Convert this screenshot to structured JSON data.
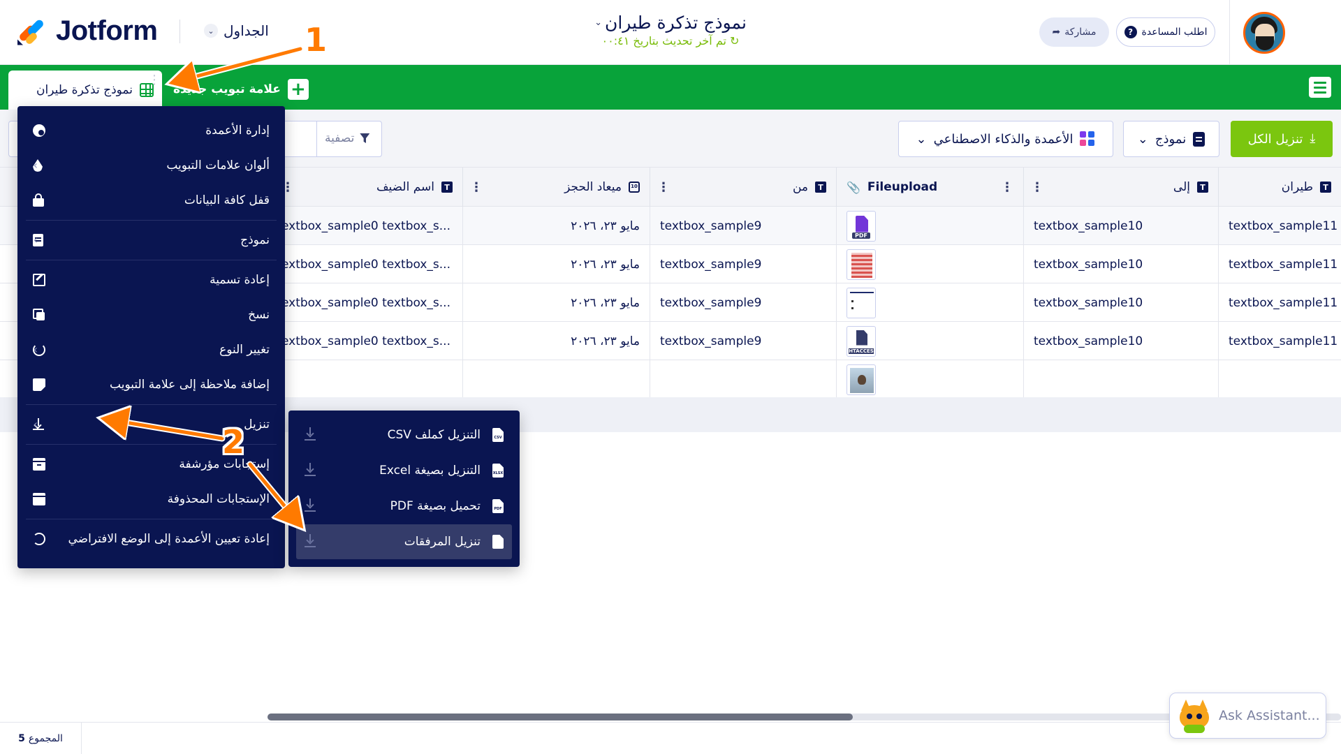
{
  "header": {
    "logo_text": "Jotform",
    "tables_label": "الجداول",
    "form_title": "نموذج تذكرة طيران",
    "subtitle": "تم آخر تحديث بتاريخ ٠٠:٤١",
    "share_label": "مشاركة",
    "help_label": "اطلب المساعدة"
  },
  "tabs": {
    "active_tab": "نموذج تذكرة طيران",
    "new_tab": "علامة تبويب جديدة"
  },
  "toolbar": {
    "filter_label": "تصفية",
    "ai_columns_label": "الأعمدة والذكاء الاصطناعي",
    "form_label": "نموذج",
    "download_all_label": "تنزيل الكل"
  },
  "table": {
    "columns": [
      "طيران",
      "إلى",
      "Fileupload",
      "من",
      "ميعاد الحجز",
      "اسم الضيف"
    ],
    "rows": [
      {
        "flight": "textbox_sample11",
        "to": "textbox_sample10",
        "file": "pdf",
        "from": "textbox_sample9",
        "date": "مايو ٢٣، ٢٠٢٦",
        "guest": "extbox_sample0 textbox_s..."
      },
      {
        "flight": "textbox_sample11",
        "to": "textbox_sample10",
        "file": "image",
        "from": "textbox_sample9",
        "date": "مايو ٢٣، ٢٠٢٦",
        "guest": "extbox_sample0 textbox_s..."
      },
      {
        "flight": "textbox_sample11",
        "to": "textbox_sample10",
        "file": "doc",
        "from": "textbox_sample9",
        "date": "مايو ٢٣، ٢٠٢٦",
        "guest": "extbox_sample0 textbox_s..."
      },
      {
        "flight": "textbox_sample11",
        "to": "textbox_sample10",
        "file": "htaccess",
        "from": "textbox_sample9",
        "date": "مايو ٢٣، ٢٠٢٦",
        "guest": "extbox_sample0 textbox_s..."
      },
      {
        "flight": "",
        "to": "",
        "file": "photo",
        "from": "",
        "date": "",
        "guest": ""
      }
    ],
    "pdf_badge": "PDF",
    "htaccess_badge": "HTACCES"
  },
  "menu": {
    "items": [
      "إدارة الأعمدة",
      "ألوان علامات التبويب",
      "قفل كافة البيانات",
      "نموذج",
      "إعادة تسمية",
      "نسخ",
      "تغيير النوع",
      "إضافة ملاحظة إلى علامة التبويب",
      "تنزيل",
      "إستجابات مؤرشفة",
      "الإستجابات المحذوفة",
      "إعادة تعيين الأعمدة إلى الوضع الافتراضي"
    ]
  },
  "submenu": {
    "items": [
      {
        "label": "التنزيل كملف CSV",
        "badge": "CSV"
      },
      {
        "label": "التنزيل بصيغة Excel",
        "badge": "XLSX"
      },
      {
        "label": "تحميل بصيغة PDF",
        "badge": "PDF"
      },
      {
        "label": "تنزيل المرفقات",
        "badge": ""
      }
    ]
  },
  "annotations": {
    "step1": "1",
    "step2": "2"
  },
  "footer": {
    "total_label": "المجموع",
    "total_value": "5"
  },
  "assistant": {
    "label": "Ask Assistant..."
  },
  "colors": {
    "brand_green": "#08a33a",
    "accent_green": "#7bc60f",
    "navy": "#0a1551",
    "annotation_orange": "#ff7a00"
  }
}
